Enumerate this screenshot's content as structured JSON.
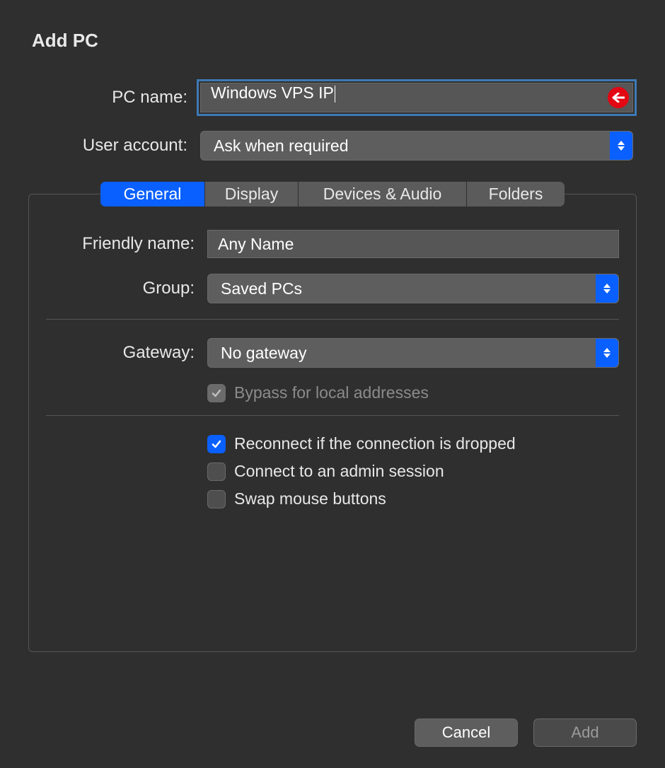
{
  "title": "Add PC",
  "fields": {
    "pc_name": {
      "label": "PC name:",
      "value": "Windows VPS IP"
    },
    "user_account": {
      "label": "User account:",
      "value": "Ask when required"
    }
  },
  "tabs": [
    "General",
    "Display",
    "Devices & Audio",
    "Folders"
  ],
  "general": {
    "friendly_name": {
      "label": "Friendly name:",
      "value": "Any Name"
    },
    "group": {
      "label": "Group:",
      "value": "Saved PCs"
    },
    "gateway": {
      "label": "Gateway:",
      "value": "No gateway"
    },
    "bypass_label": "Bypass for local addresses",
    "reconnect_label": "Reconnect if the connection is dropped",
    "admin_label": "Connect to an admin session",
    "swap_label": "Swap mouse buttons"
  },
  "buttons": {
    "cancel": "Cancel",
    "add": "Add"
  },
  "colors": {
    "accent": "#0a60ff",
    "annotation": "#e30613"
  }
}
